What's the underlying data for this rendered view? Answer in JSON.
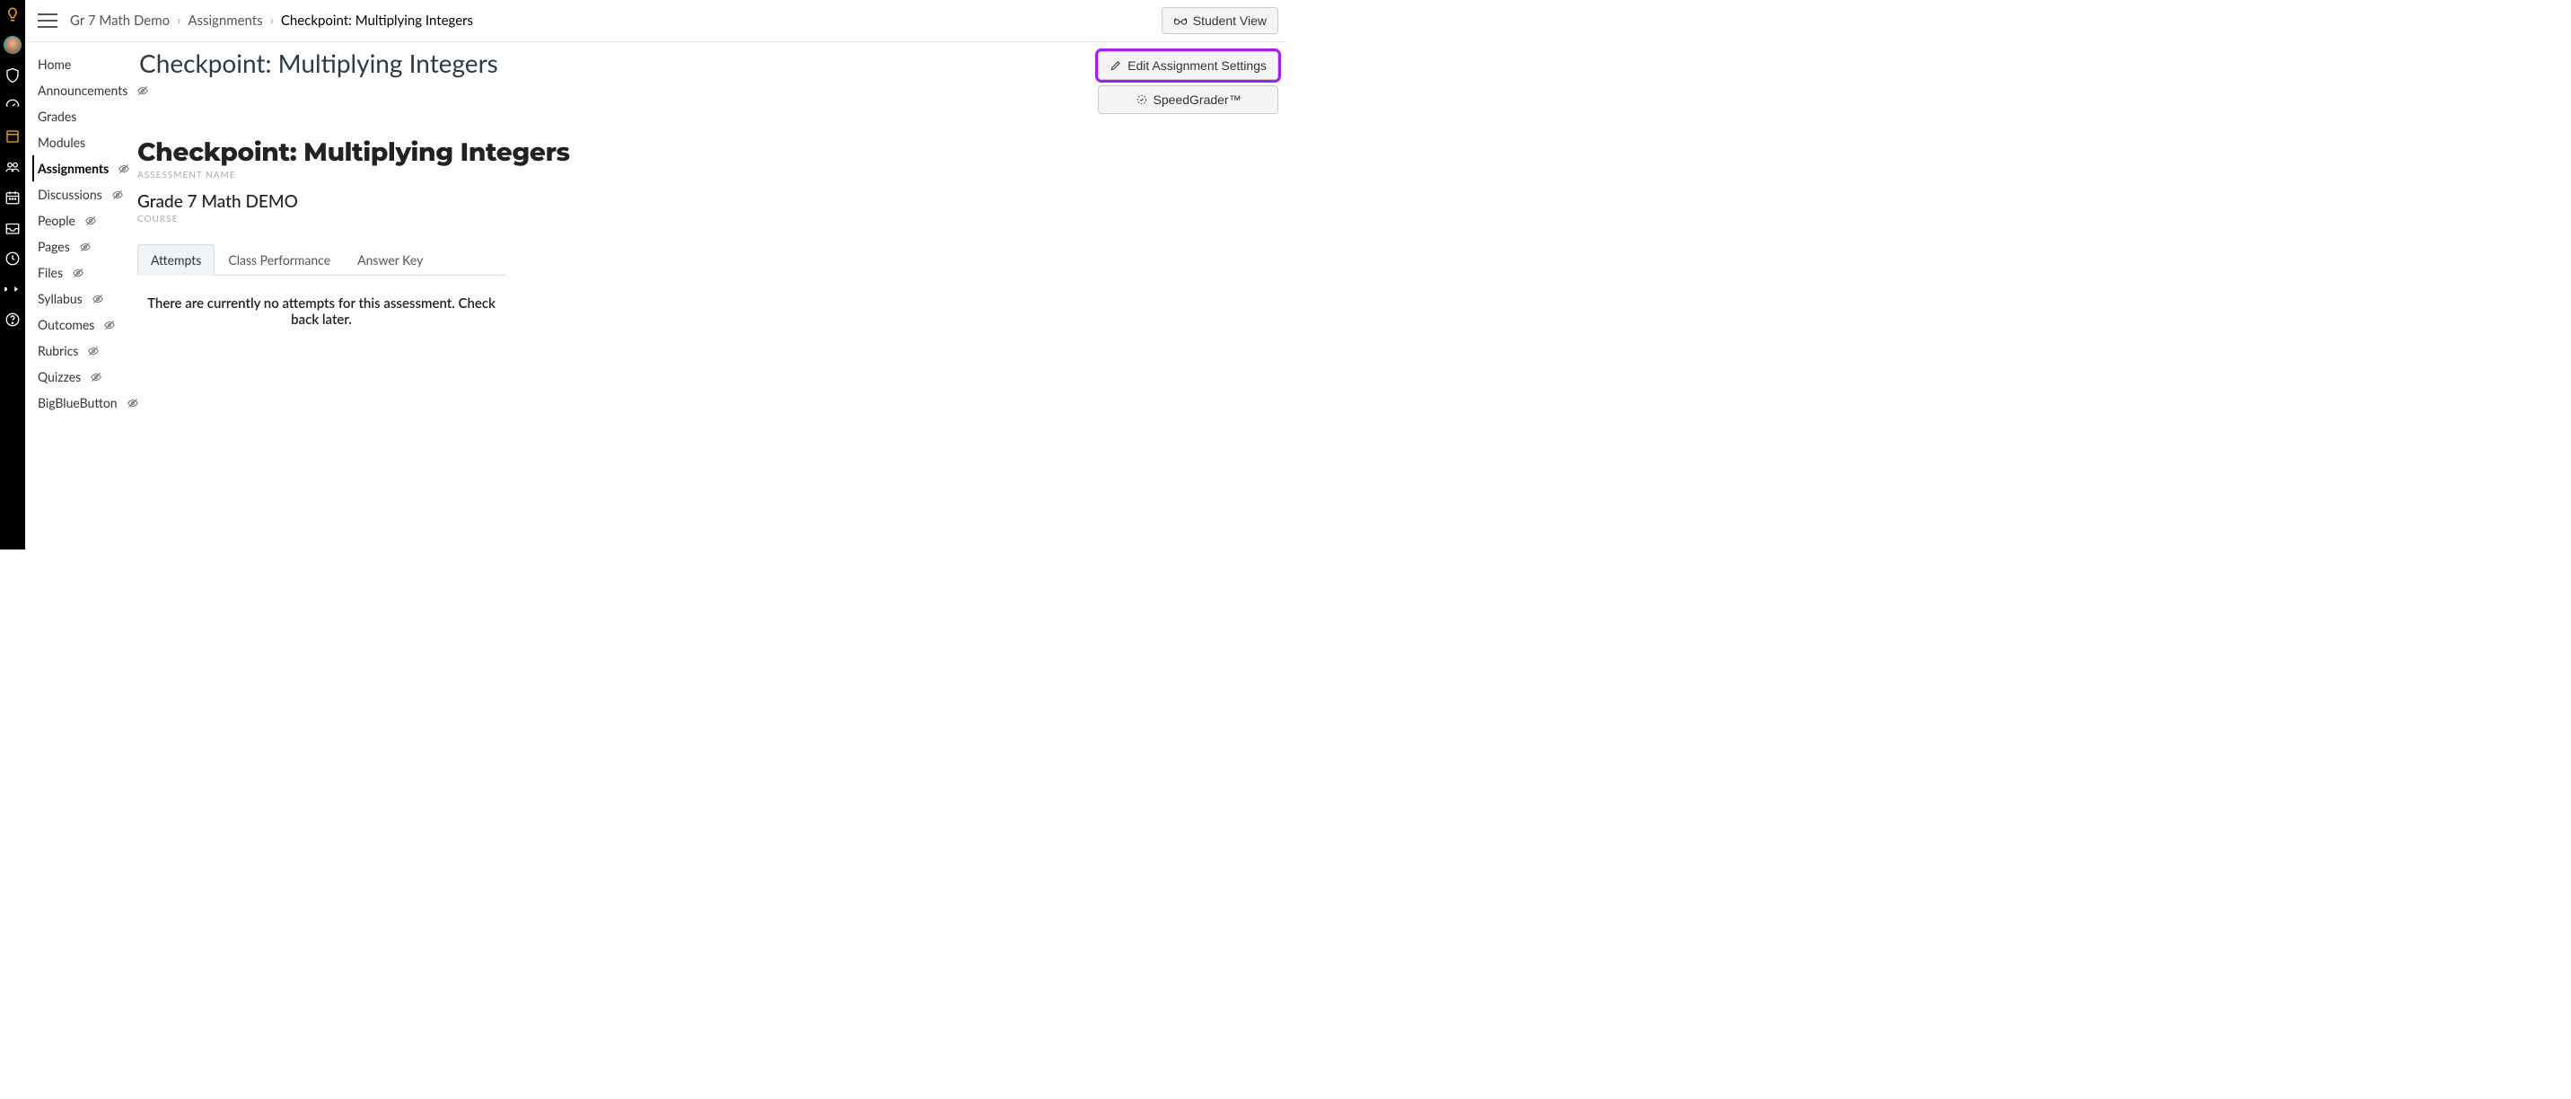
{
  "breadcrumbs": {
    "course": "Gr 7 Math Demo",
    "section": "Assignments",
    "current": "Checkpoint: Multiplying Integers"
  },
  "topbar": {
    "student_view": "Student View"
  },
  "course_nav": {
    "items": [
      {
        "label": "Home",
        "hidden": false,
        "active": false
      },
      {
        "label": "Announcements",
        "hidden": true,
        "active": false
      },
      {
        "label": "Grades",
        "hidden": false,
        "active": false
      },
      {
        "label": "Modules",
        "hidden": false,
        "active": false
      },
      {
        "label": "Assignments",
        "hidden": true,
        "active": true
      },
      {
        "label": "Discussions",
        "hidden": true,
        "active": false
      },
      {
        "label": "People",
        "hidden": true,
        "active": false
      },
      {
        "label": "Pages",
        "hidden": true,
        "active": false
      },
      {
        "label": "Files",
        "hidden": true,
        "active": false
      },
      {
        "label": "Syllabus",
        "hidden": true,
        "active": false
      },
      {
        "label": "Outcomes",
        "hidden": true,
        "active": false
      },
      {
        "label": "Rubrics",
        "hidden": true,
        "active": false
      },
      {
        "label": "Quizzes",
        "hidden": true,
        "active": false
      },
      {
        "label": "BigBlueButton",
        "hidden": true,
        "active": false
      }
    ]
  },
  "page": {
    "title": "Checkpoint: Multiplying Integers",
    "actions": {
      "edit_settings": "Edit Assignment Settings",
      "speedgrader": "SpeedGrader™"
    },
    "assessment_name": "Checkpoint: Multiplying Integers",
    "assessment_label": "ASSESSMENT NAME",
    "course_name": "Grade 7 Math DEMO",
    "course_label": "COURSE",
    "tabs": {
      "attempts": "Attempts",
      "class_performance": "Class Performance",
      "answer_key": "Answer Key"
    },
    "empty_message": "There are currently no attempts for this assessment. Check back later."
  }
}
